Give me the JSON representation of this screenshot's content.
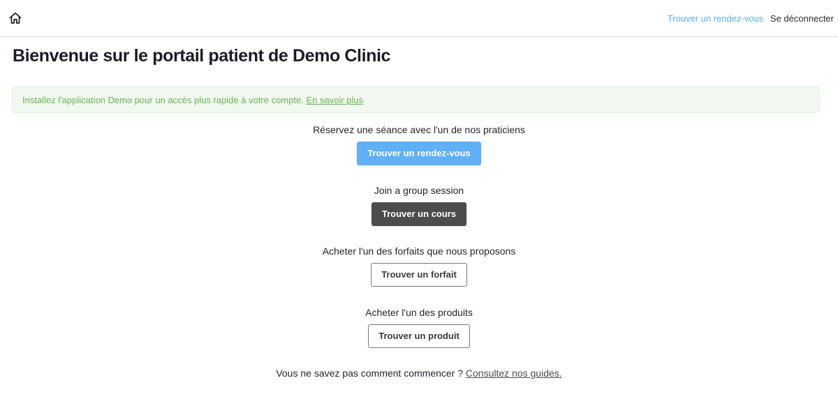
{
  "header": {
    "home_icon": "home-icon",
    "nav": {
      "find_appointment": "Trouver un rendez-vous",
      "logout": "Se déconnecter"
    }
  },
  "main": {
    "title": "Bienvenue sur le portail patient de Demo Clinic",
    "banner": {
      "text": "Installez l'application Demo pour un accès plus rapide à votre compte.",
      "link": "En savoir plus"
    },
    "sections": [
      {
        "label": "Réservez une séance avec l'un de nos praticiens",
        "button": "Trouver un rendez-vous"
      },
      {
        "label": "Join a group session",
        "button": "Trouver un cours"
      },
      {
        "label": "Acheter l'un des forfaits que nous proposons",
        "button": "Trouver un forfait"
      },
      {
        "label": "Acheter l'un des produits",
        "button": "Trouver un produit"
      }
    ],
    "help": {
      "text": "Vous ne savez pas comment commencer ?",
      "link": "Consultez nos guides."
    }
  },
  "colors": {
    "accent": "#5fb0f4",
    "dark_button": "#4c4c4c",
    "banner_bg": "#f1f8ef",
    "banner_text": "#69b454"
  }
}
